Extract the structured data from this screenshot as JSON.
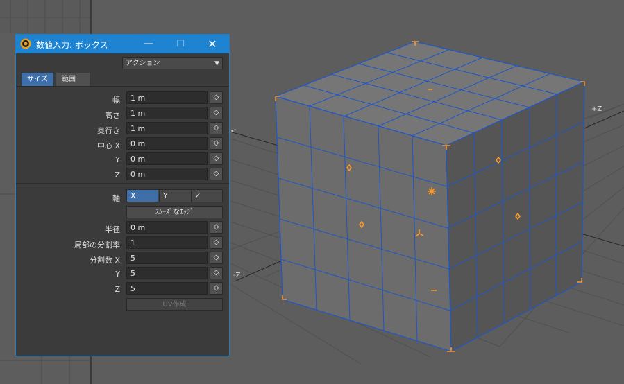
{
  "viewport": {
    "axis_plus_z": "+Z",
    "axis_minus_z": "-Z",
    "colors": {
      "background": "#5d5d5d",
      "cube_face": "#737373",
      "edge": "#1d56c8",
      "handle": "#ff9c28"
    }
  },
  "window": {
    "title": "数値入力: ボックス",
    "icon": "app-logo-icon",
    "controls": {
      "minimize": "—",
      "maximize": "☐",
      "close": "✕"
    }
  },
  "action": {
    "label": "アクション",
    "icon": "chevron-down-icon"
  },
  "tabs": [
    {
      "label": "サイズ",
      "selected": true
    },
    {
      "label": "範囲",
      "selected": false
    }
  ],
  "fields": {
    "width": {
      "label": "幅",
      "value": "1 m"
    },
    "height": {
      "label": "高さ",
      "value": "1 m"
    },
    "depth": {
      "label": "奥行き",
      "value": "1 m"
    },
    "center_x": {
      "label": "中心 X",
      "value": "0 m"
    },
    "center_y": {
      "label": "Y",
      "value": "0 m"
    },
    "center_z": {
      "label": "Z",
      "value": "0 m"
    },
    "radius": {
      "label": "半径",
      "value": "0 m"
    },
    "local_div": {
      "label": "局部の分割率",
      "value": "1"
    },
    "segments_x": {
      "label": "分割数 X",
      "value": "5"
    },
    "segments_y": {
      "label": "Y",
      "value": "5"
    },
    "segments_z": {
      "label": "Z",
      "value": "5"
    }
  },
  "axis": {
    "label": "軸",
    "options": [
      "X",
      "Y",
      "Z"
    ],
    "selected": "X"
  },
  "smooth_edge_label": "ｽﾑｰｽﾞなｴｯｼﾞ",
  "uv_label": "UV作成",
  "stepper_glyph": "◇"
}
